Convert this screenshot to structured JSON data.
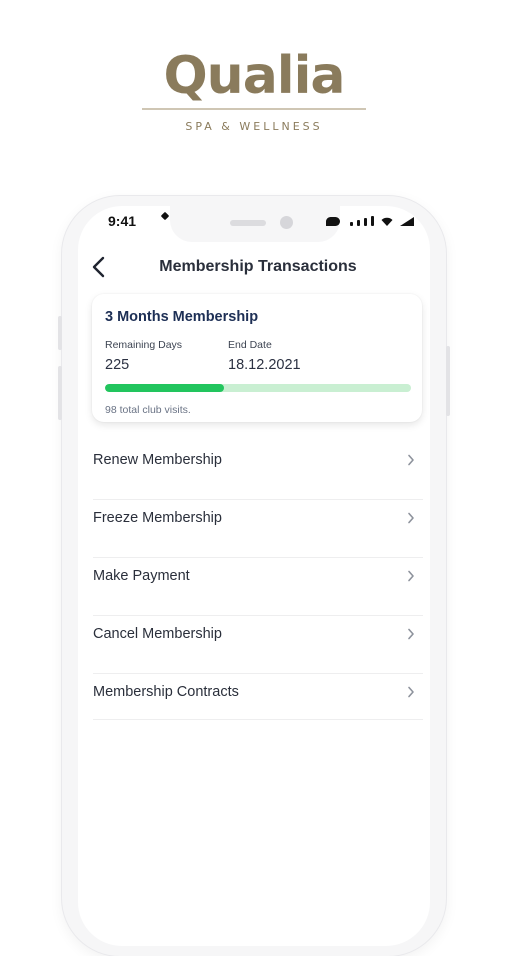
{
  "logo": {
    "wordmark": "Qualia",
    "tagline": "SPA & WELLNESS"
  },
  "status_bar": {
    "time": "9:41"
  },
  "header": {
    "title": "Membership Transactions",
    "back_icon": "chevron-left-icon"
  },
  "membership": {
    "name": "3 Months Membership",
    "remaining_label": "Remaining Days",
    "remaining_value": "225",
    "end_label": "End Date",
    "end_value": "18.12.2021",
    "progress_fraction": 0.39,
    "visits_note": "98 total club visits."
  },
  "menu": [
    {
      "label": "Renew Membership"
    },
    {
      "label": "Freeze Membership"
    },
    {
      "label": "Make Payment"
    },
    {
      "label": "Cancel Membership"
    },
    {
      "label": "Membership Contracts"
    }
  ],
  "colors": {
    "brand": "#8a7b5c",
    "card_title": "#1d2f55",
    "progress_fill": "#22c55e",
    "progress_track": "#c9efd2"
  }
}
